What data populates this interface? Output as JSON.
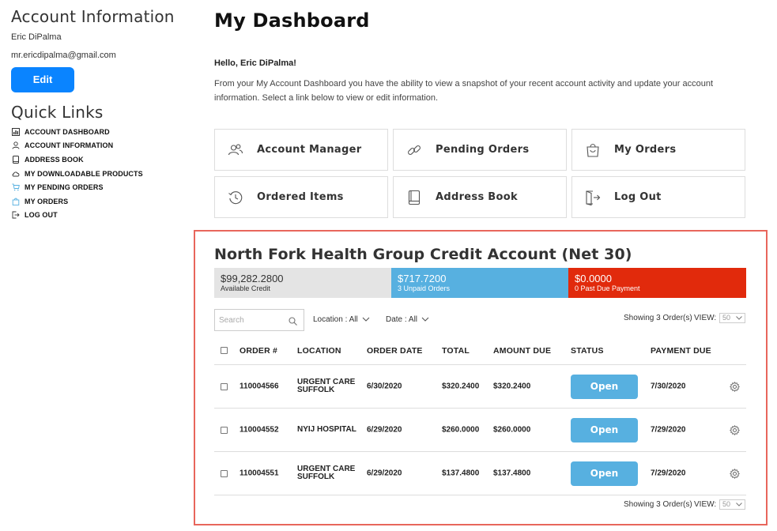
{
  "sidebar": {
    "account_title": "Account Information",
    "user_name": "Eric DiPalma",
    "email": "mr.ericdipalma@gmail.com",
    "edit_label": "Edit",
    "quick_links_title": "Quick Links",
    "links": [
      {
        "label": "ACCOUNT DASHBOARD",
        "icon": "dashboard-icon"
      },
      {
        "label": "ACCOUNT INFORMATION",
        "icon": "user-icon"
      },
      {
        "label": "ADDRESS BOOK",
        "icon": "book-icon"
      },
      {
        "label": "MY DOWNLOADABLE PRODUCTS",
        "icon": "cloud-download-icon"
      },
      {
        "label": "MY PENDING ORDERS",
        "icon": "cart-icon"
      },
      {
        "label": "MY ORDERS",
        "icon": "shopping-bag-icon"
      },
      {
        "label": "LOG OUT",
        "icon": "logout-icon"
      }
    ]
  },
  "main": {
    "title": "My Dashboard",
    "hello": "Hello, Eric DiPalma!",
    "intro": "From your My Account Dashboard you have the ability to view a snapshot of your recent account activity and update your account information. Select a link below to view or edit information.",
    "tiles": [
      {
        "label": "Account Manager",
        "icon": "users-icon"
      },
      {
        "label": "Pending Orders",
        "icon": "link-icon"
      },
      {
        "label": "My Orders",
        "icon": "shopping-bag-icon"
      },
      {
        "label": "Ordered Items",
        "icon": "history-icon"
      },
      {
        "label": "Address Book",
        "icon": "book-icon"
      },
      {
        "label": "Log Out",
        "icon": "logout-icon"
      }
    ]
  },
  "credit": {
    "title": "North Fork Health Group Credit Account (Net 30)",
    "available_amount": "$99,282.2800",
    "available_label": "Available Credit",
    "unpaid_amount": "$717.7200",
    "unpaid_label": "3 Unpaid Orders",
    "past_due_amount": "$0.0000",
    "past_due_label": "0 Past Due Payment",
    "colors": {
      "available": "#e4e4e4",
      "unpaid": "#57b0e0",
      "past_due": "#e12a0c",
      "frame": "#e8665c"
    }
  },
  "filters": {
    "search_placeholder": "Search",
    "location_label": "Location : All",
    "date_label": "Date : All",
    "showing_text": "Showing 3 Order(s)",
    "view_label": "VIEW:",
    "view_value": "50"
  },
  "orders": {
    "columns": [
      "ORDER #",
      "LOCATION",
      "ORDER DATE",
      "TOTAL",
      "AMOUNT DUE",
      "STATUS",
      "PAYMENT DUE"
    ],
    "rows": [
      {
        "order": "110004566",
        "location": "URGENT CARE SUFFOLK",
        "date": "6/30/2020",
        "total": "$320.2400",
        "amount_due": "$320.2400",
        "status": "Open",
        "payment_due": "7/30/2020"
      },
      {
        "order": "110004552",
        "location": "NYIJ HOSPITAL",
        "date": "6/29/2020",
        "total": "$260.0000",
        "amount_due": "$260.0000",
        "status": "Open",
        "payment_due": "7/29/2020"
      },
      {
        "order": "110004551",
        "location": "URGENT CARE SUFFOLK",
        "date": "6/29/2020",
        "total": "$137.4800",
        "amount_due": "$137.4800",
        "status": "Open",
        "payment_due": "7/29/2020"
      }
    ]
  }
}
